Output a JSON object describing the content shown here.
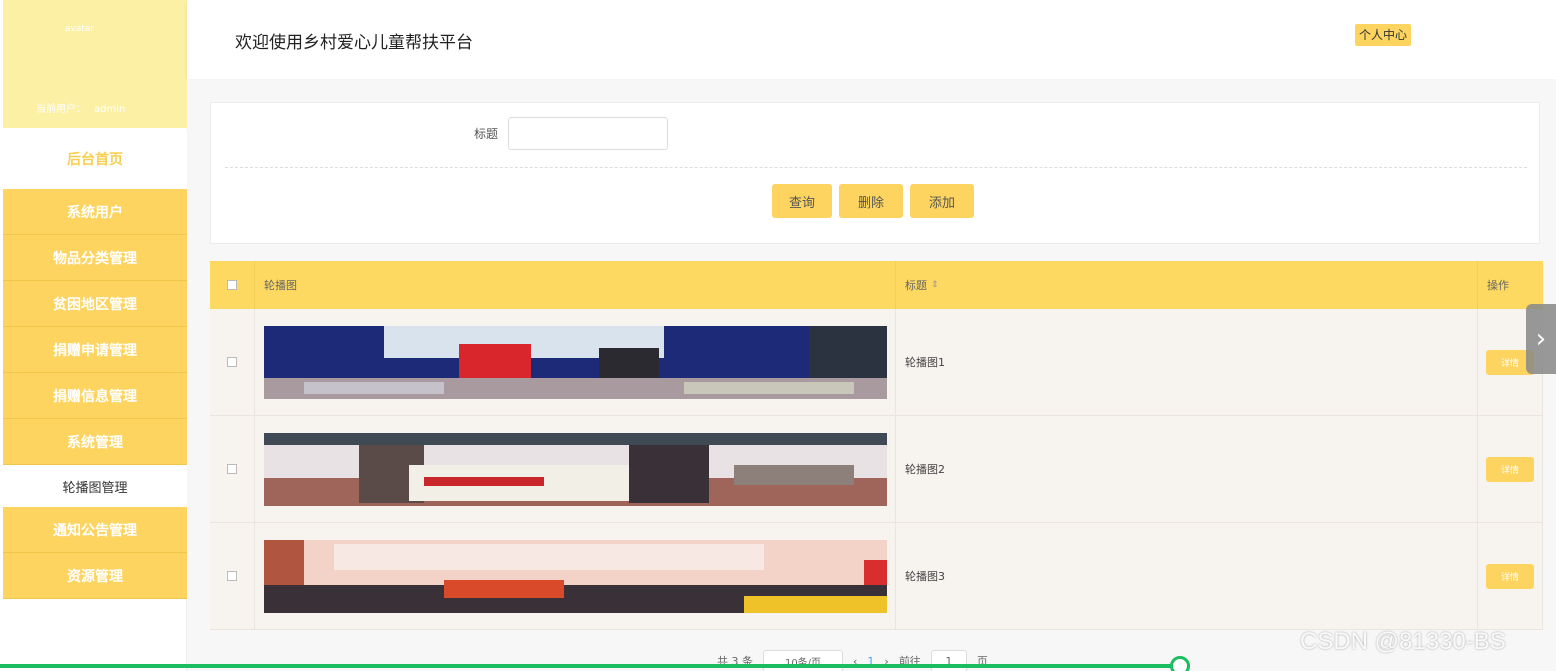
{
  "sidebar": {
    "avatar_alt": "avatar",
    "current_user_label": "当前用户：",
    "current_user_name": "admin",
    "home": "后台首页",
    "items": [
      {
        "label": "系统用户"
      },
      {
        "label": "物品分类管理"
      },
      {
        "label": "贫困地区管理"
      },
      {
        "label": "捐赠申请管理"
      },
      {
        "label": "捐赠信息管理"
      },
      {
        "label": "系统管理"
      },
      {
        "label": "轮播图管理"
      },
      {
        "label": "通知公告管理"
      },
      {
        "label": "资源管理"
      }
    ]
  },
  "header": {
    "title": "欢迎使用乡村爱心儿童帮扶平台",
    "profile_button": "个人中心"
  },
  "search": {
    "title_label": "标题",
    "title_value": "",
    "query_button": "查询",
    "delete_button": "删除",
    "add_button": "添加"
  },
  "table": {
    "headers": {
      "image": "轮播图",
      "title": "标题",
      "operation": "操作"
    },
    "rows": [
      {
        "title": "轮播图1",
        "detail": "详情"
      },
      {
        "title": "轮播图2",
        "detail": "详情"
      },
      {
        "title": "轮播图3",
        "detail": "详情"
      }
    ]
  },
  "pagination": {
    "total": "共 3 条",
    "page_size": "10条/页",
    "prev": "‹",
    "current_page": "1",
    "next": "›",
    "goto_label": "前往",
    "goto_value": "1",
    "page_unit": "页"
  },
  "overlay": {
    "watermark": "CSDN @81330-BS",
    "arrow": "›"
  },
  "colors": {
    "accent": "#fcd45f",
    "header_row": "#fdd962",
    "sidebar_top": "#fbf0a4",
    "progress": "#1bbd60"
  }
}
